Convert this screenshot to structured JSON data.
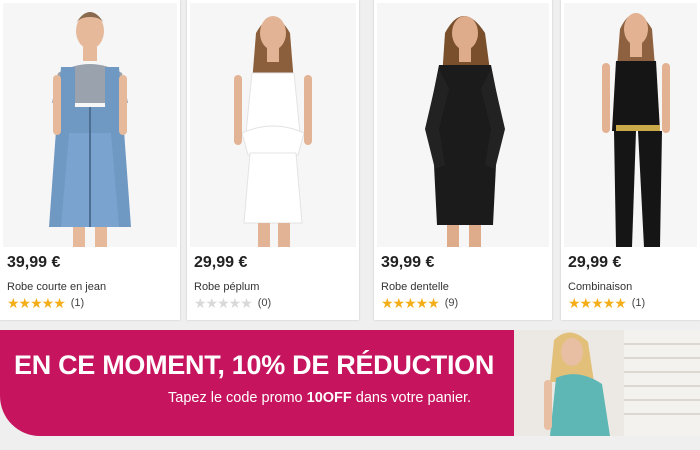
{
  "products": [
    {
      "price": "39,99 €",
      "name": "Robe courte en jean",
      "rating": 5,
      "reviews": "(1)",
      "image": "denim-overall-dress-photo"
    },
    {
      "price": "29,99 €",
      "name": "Robe péplum",
      "rating": 0,
      "reviews": "(0)",
      "image": "white-peplum-dress-photo"
    },
    {
      "price": "39,99 €",
      "name": "Robe dentelle",
      "rating": 5,
      "reviews": "(9)",
      "image": "black-lace-dress-photo"
    },
    {
      "price": "29,99 €",
      "name": "Combinaison",
      "rating": 5,
      "reviews": "(1)",
      "image": "black-jumpsuit-photo"
    }
  ],
  "banner": {
    "headline": "EN CE MOMENT, 10% DE RÉDUCTION",
    "sub_before": "Tapez le code promo ",
    "code": "10OFF",
    "sub_after": " dans votre panier.",
    "image": "model-teal-top-photo"
  },
  "colors": {
    "banner": "#c6155e",
    "star": "#f4ae1a",
    "star_empty": "#d9d9d9"
  }
}
